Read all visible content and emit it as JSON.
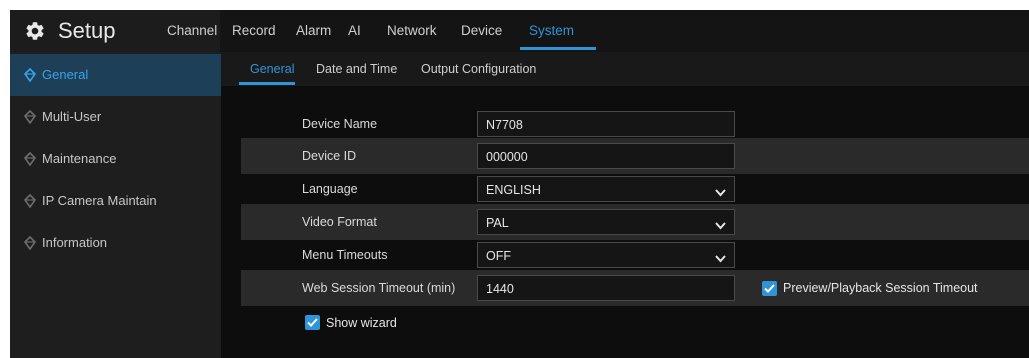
{
  "header": {
    "title": "Setup",
    "icon": "gear-icon",
    "tabs": [
      {
        "label": "Channel",
        "active": false
      },
      {
        "label": "Record",
        "active": false
      },
      {
        "label": "Alarm",
        "active": false
      },
      {
        "label": "AI",
        "active": false
      },
      {
        "label": "Network",
        "active": false
      },
      {
        "label": "Device",
        "active": false
      },
      {
        "label": "System",
        "active": true
      }
    ]
  },
  "sidebar": {
    "items": [
      {
        "label": "General",
        "active": true
      },
      {
        "label": "Multi-User",
        "active": false
      },
      {
        "label": "Maintenance",
        "active": false
      },
      {
        "label": "IP Camera Maintain",
        "active": false
      },
      {
        "label": "Information",
        "active": false
      }
    ]
  },
  "subtabs": [
    {
      "label": "General",
      "active": true
    },
    {
      "label": "Date and Time",
      "active": false
    },
    {
      "label": "Output Configuration",
      "active": false
    }
  ],
  "form": {
    "device_name": {
      "label": "Device Name",
      "value": "N7708"
    },
    "device_id": {
      "label": "Device ID",
      "value": "000000"
    },
    "language": {
      "label": "Language",
      "value": "ENGLISH"
    },
    "video_format": {
      "label": "Video Format",
      "value": "PAL"
    },
    "menu_timeouts": {
      "label": "Menu Timeouts",
      "value": "OFF"
    },
    "web_session_timeout": {
      "label": "Web Session Timeout (min)",
      "value": "1440"
    },
    "preview_playback_timeout": {
      "label": "Preview/Playback Session Timeout",
      "checked": true
    },
    "show_wizard": {
      "label": "Show wizard",
      "checked": true
    }
  },
  "colors": {
    "accent": "#2f95d8",
    "header_bg": "#141414",
    "sidebar_bg": "#1e1e1e",
    "sidebar_active_bg": "#1d3f58",
    "main_bg": "#0d0d0d",
    "row_shaded_bg": "#2a2a2a"
  }
}
